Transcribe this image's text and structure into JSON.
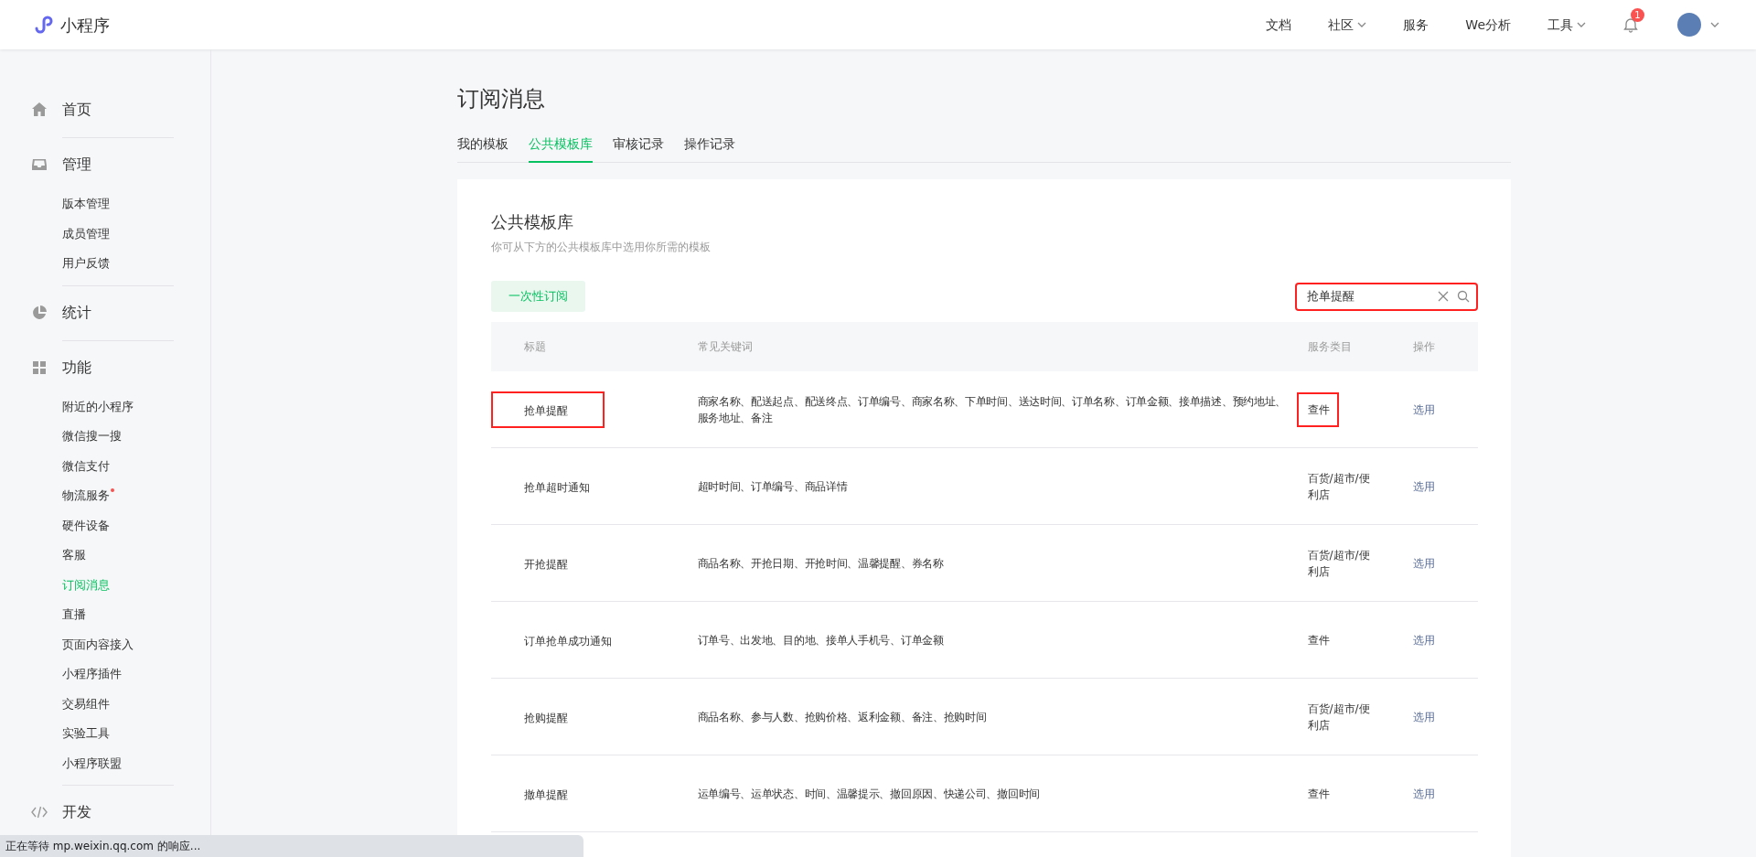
{
  "header": {
    "logo_text": "小程序",
    "nav": [
      {
        "label": "文档",
        "dropdown": false
      },
      {
        "label": "社区",
        "dropdown": true
      },
      {
        "label": "服务",
        "dropdown": false
      },
      {
        "label": "We分析",
        "dropdown": false
      },
      {
        "label": "工具",
        "dropdown": true
      }
    ],
    "notification_count": "1"
  },
  "sidebar": {
    "groups": [
      {
        "label": "首页"
      },
      {
        "label": "管理",
        "items": [
          {
            "label": "版本管理",
            "selected": false,
            "dot": false
          },
          {
            "label": "成员管理",
            "selected": false,
            "dot": false
          },
          {
            "label": "用户反馈",
            "selected": false,
            "dot": false
          }
        ]
      },
      {
        "label": "统计"
      },
      {
        "label": "功能",
        "items": [
          {
            "label": "附近的小程序",
            "selected": false,
            "dot": false
          },
          {
            "label": "微信搜一搜",
            "selected": false,
            "dot": false
          },
          {
            "label": "微信支付",
            "selected": false,
            "dot": false
          },
          {
            "label": "物流服务",
            "selected": false,
            "dot": true
          },
          {
            "label": "硬件设备",
            "selected": false,
            "dot": false
          },
          {
            "label": "客服",
            "selected": false,
            "dot": false
          },
          {
            "label": "订阅消息",
            "selected": true,
            "dot": false
          },
          {
            "label": "直播",
            "selected": false,
            "dot": false
          },
          {
            "label": "页面内容接入",
            "selected": false,
            "dot": false
          },
          {
            "label": "小程序插件",
            "selected": false,
            "dot": false
          },
          {
            "label": "交易组件",
            "selected": false,
            "dot": false
          },
          {
            "label": "实验工具",
            "selected": false,
            "dot": false
          },
          {
            "label": "小程序联盟",
            "selected": false,
            "dot": false
          }
        ]
      },
      {
        "label": "开发"
      }
    ]
  },
  "page": {
    "title": "订阅消息",
    "tabs": [
      {
        "label": "我的模板",
        "selected": false
      },
      {
        "label": "公共模板库",
        "selected": true
      },
      {
        "label": "审核记录",
        "selected": false
      },
      {
        "label": "操作记录",
        "selected": false
      }
    ]
  },
  "panel": {
    "title": "公共模板库",
    "subtitle": "你可从下方的公共模板库中选用你所需的模板",
    "filters": [
      {
        "label": "一次性订阅",
        "selected": true
      }
    ],
    "search": {
      "value": "抢单提醒",
      "highlighted": true
    },
    "table": {
      "columns": [
        "标题",
        "常见关键词",
        "服务类目",
        "操作"
      ],
      "rows": [
        {
          "title": "抢单提醒",
          "keywords": "商家名称、配送起点、配送终点、订单编号、商家名称、下单时间、送达时间、订单名称、订单金额、接单描述、预约地址、服务地址、备注",
          "category": "查件",
          "action": "选用",
          "highlighted": true
        },
        {
          "title": "抢单超时通知",
          "keywords": "超时时间、订单编号、商品详情",
          "category": "百货/超市/便利店",
          "action": "选用",
          "highlighted": false
        },
        {
          "title": "开抢提醒",
          "keywords": "商品名称、开抢日期、开抢时间、温馨提醒、券名称",
          "category": "百货/超市/便利店",
          "action": "选用",
          "highlighted": false
        },
        {
          "title": "订单抢单成功通知",
          "keywords": "订单号、出发地、目的地、接单人手机号、订单金额",
          "category": "查件",
          "action": "选用",
          "highlighted": false
        },
        {
          "title": "抢购提醒",
          "keywords": "商品名称、参与人数、抢购价格、返利金额、备注、抢购时间",
          "category": "百货/超市/便利店",
          "action": "选用",
          "highlighted": false
        },
        {
          "title": "撤单提醒",
          "keywords": "运单编号、运单状态、时间、温馨提示、撤回原因、快递公司、撤回时间",
          "category": "查件",
          "action": "选用",
          "highlighted": false
        }
      ]
    }
  },
  "status_bar": "正在等待 mp.weixin.qq.com 的响应..."
}
